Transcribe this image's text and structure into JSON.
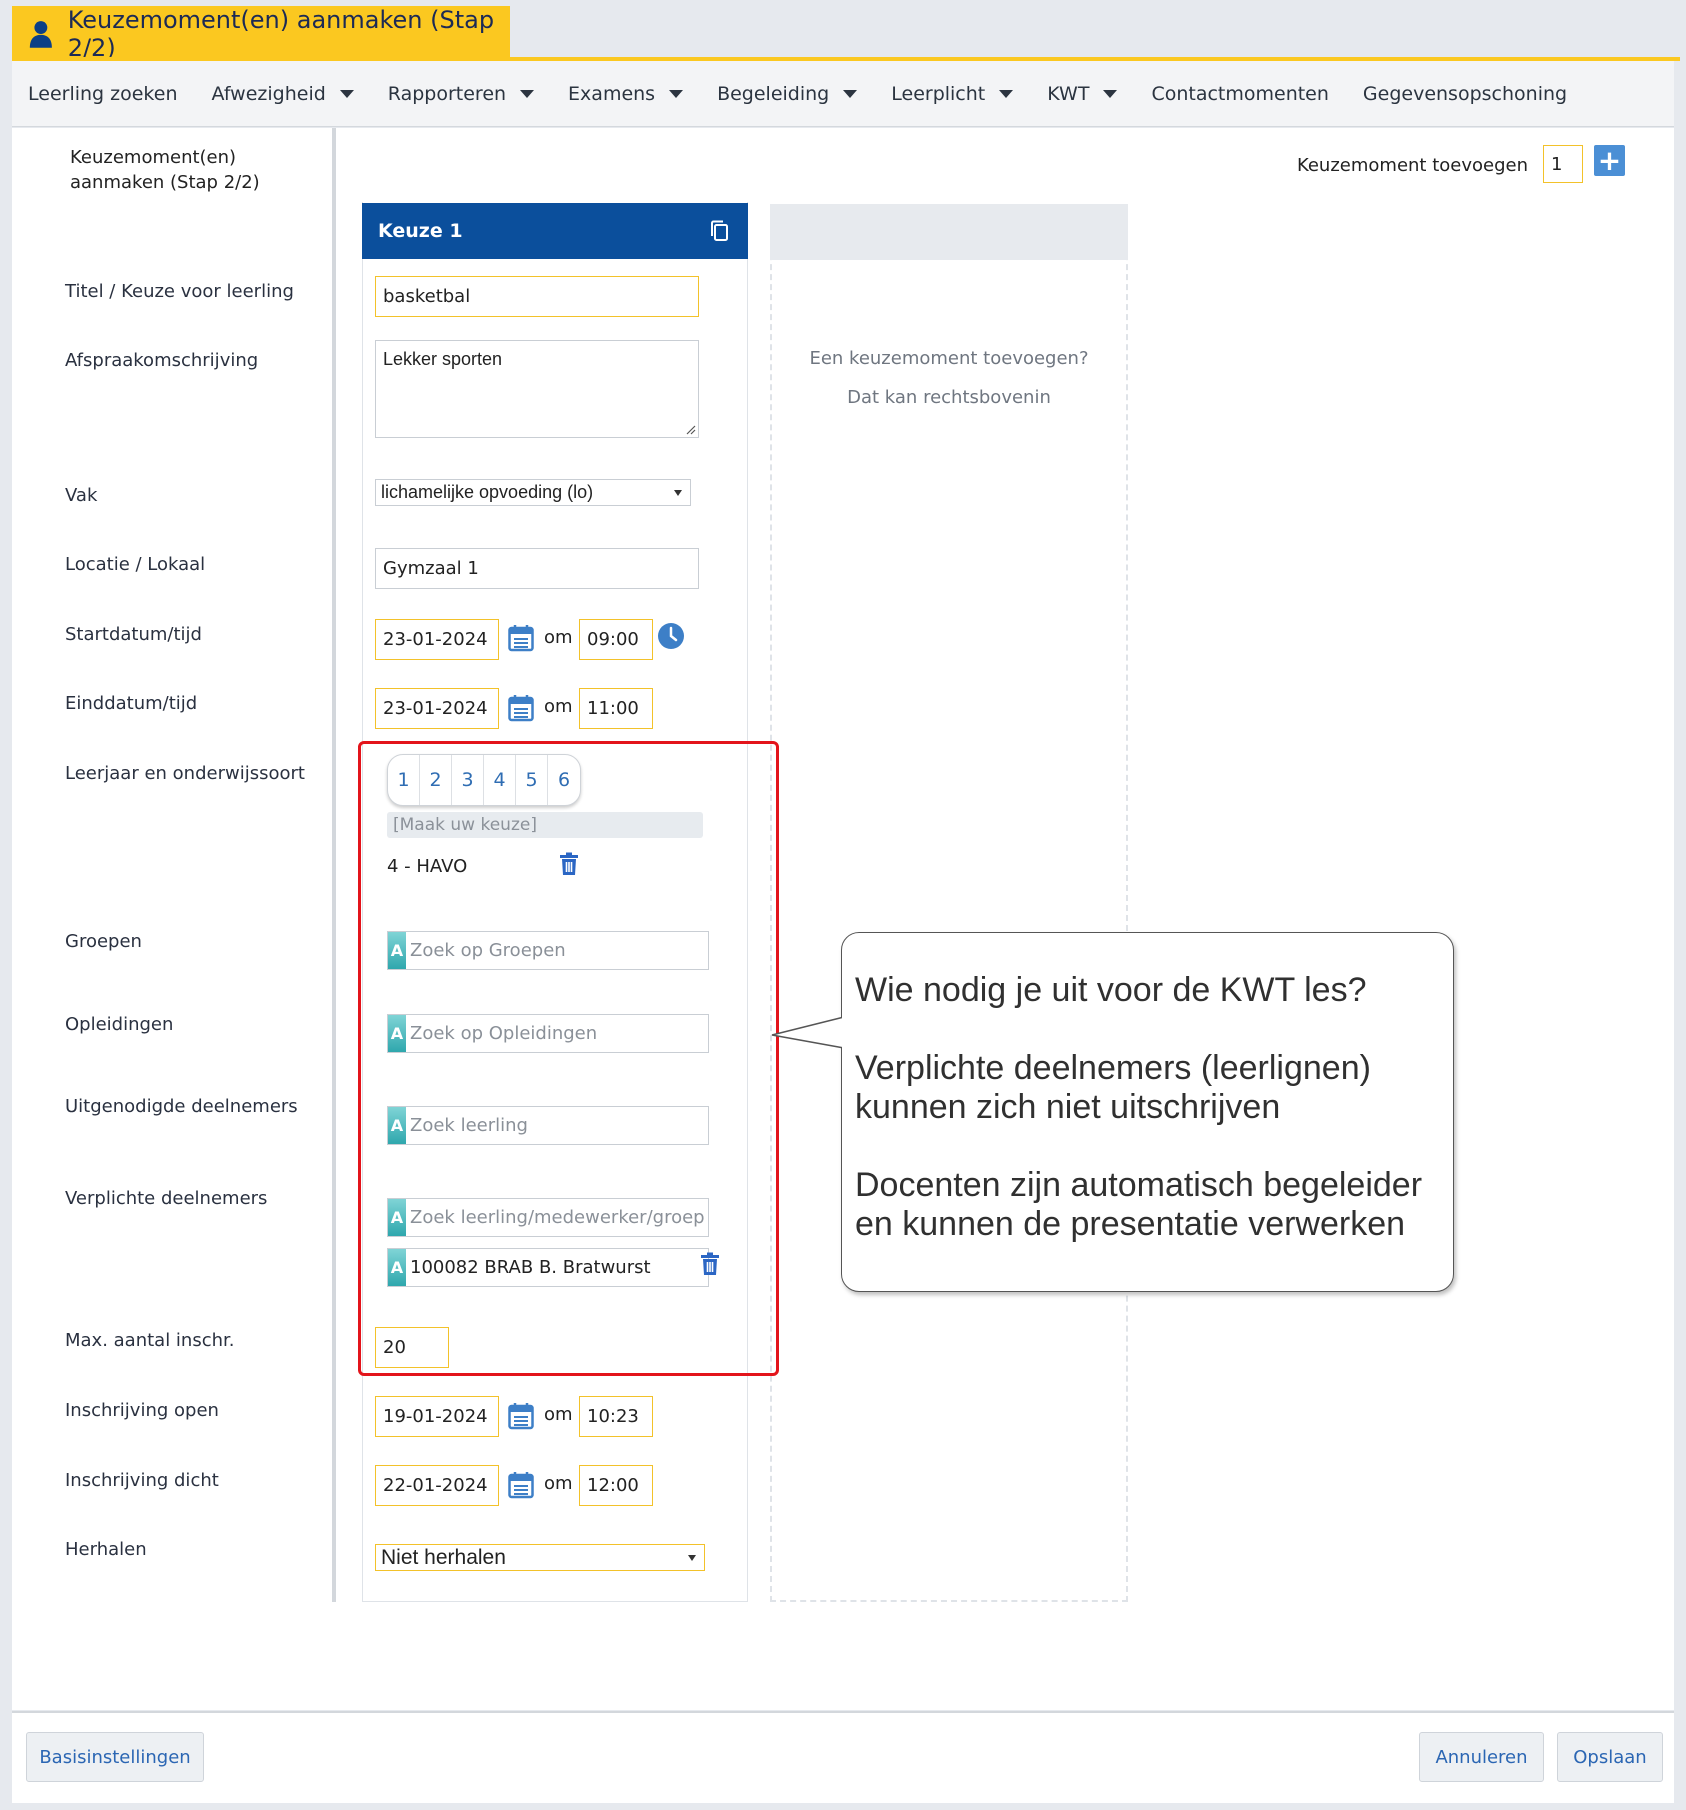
{
  "window": {
    "title": "Keuzemoment(en) aanmaken (Stap 2/2)"
  },
  "nav": [
    {
      "label": "Leerling zoeken",
      "dropdown": false
    },
    {
      "label": "Afwezigheid",
      "dropdown": true
    },
    {
      "label": "Rapporteren",
      "dropdown": true
    },
    {
      "label": "Examens",
      "dropdown": true
    },
    {
      "label": "Begeleiding",
      "dropdown": true
    },
    {
      "label": "Leerplicht",
      "dropdown": true
    },
    {
      "label": "KWT",
      "dropdown": true
    },
    {
      "label": "Contactmomenten",
      "dropdown": false
    },
    {
      "label": "Gegevensopschoning",
      "dropdown": false
    }
  ],
  "left": {
    "header": "Keuzemoment(en) aanmaken (Stap 2/2)",
    "labels": {
      "titel": "Titel / Keuze voor leerling",
      "afspraak": "Afspraakomschrijving",
      "vak": "Vak",
      "locatie": "Locatie / Lokaal",
      "start": "Startdatum/tijd",
      "eind": "Einddatum/tijd",
      "leerjaar": "Leerjaar en onderwijssoort",
      "groepen": "Groepen",
      "opleidingen": "Opleidingen",
      "uitgenodigd": "Uitgenodigde deelnemers",
      "verplicht": "Verplichte deelnemers",
      "max": "Max. aantal inschr.",
      "inschr_open": "Inschrijving open",
      "inschr_dicht": "Inschrijving dicht",
      "herhalen": "Herhalen"
    }
  },
  "toolbar": {
    "add_label": "Keuzemoment toevoegen",
    "add_count": "1",
    "add_icon": "plus-icon"
  },
  "card": {
    "title": "Keuze 1",
    "titel_value": "basketbal",
    "afspraak_value": "Lekker sporten",
    "vak_value": "lichamelijke opvoeding (lo)",
    "locatie_value": "Gymzaal 1",
    "om": "om",
    "start_date": "23-01-2024",
    "start_time": "09:00",
    "end_date": "23-01-2024",
    "end_time": "11:00",
    "years": [
      "1",
      "2",
      "3",
      "4",
      "5",
      "6"
    ],
    "maak_placeholder": "[Maak uw keuze]",
    "selected_year": "4 - HAVO",
    "groepen_placeholder": "Zoek op Groepen",
    "opleidingen_placeholder": "Zoek op Opleidingen",
    "uitgenodigd_placeholder": "Zoek leerling",
    "verplicht_placeholder": "Zoek leerling/medewerker/groep",
    "verplicht_value": "100082 BRAB B. Bratwurst",
    "ac_letter": "A",
    "max_value": "20",
    "open_date": "19-01-2024",
    "open_time": "10:23",
    "dicht_date": "22-01-2024",
    "dicht_time": "12:00",
    "herhalen_value": "Niet herhalen"
  },
  "empty": {
    "line1": "Een keuzemoment toevoegen?",
    "line2": "Dat kan rechtsbovenin"
  },
  "callout": {
    "p1": "Wie nodig je uit voor de KWT les?",
    "p2a": "Verplichte deelnemers (leerlignen)",
    "p2b": "kunnen zich niet uitschrijven",
    "p3a": "Docenten zijn automatisch begeleider",
    "p3b": "en kunnen de presentatie verwerken"
  },
  "footer": {
    "basis": "Basisinstellingen",
    "annuleren": "Annuleren",
    "opslaan": "Opslaan"
  },
  "colors": {
    "accent": "#fbc820",
    "brand": "#0b4f9c",
    "highlight": "#e3141b"
  }
}
